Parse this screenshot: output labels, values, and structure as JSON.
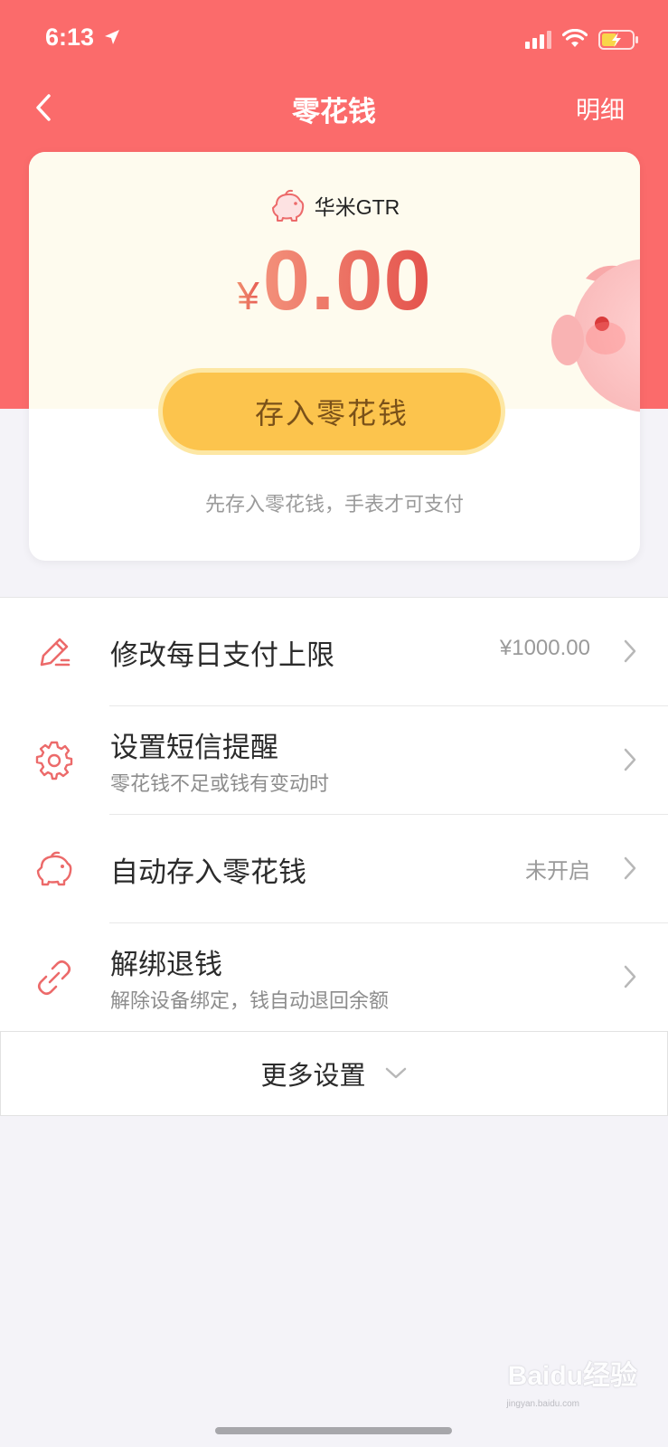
{
  "status_bar": {
    "time": "6:13"
  },
  "nav": {
    "title": "零花钱",
    "detail_link": "明细"
  },
  "card": {
    "device_name": "华米GTR",
    "currency_symbol": "¥",
    "balance": "0.00",
    "deposit_button": "存入零花钱",
    "hint": "先存入零花钱，手表才可支付"
  },
  "menu": {
    "items": [
      {
        "title": "修改每日支付上限",
        "value": "¥1000.00",
        "icon": "pencil-icon"
      },
      {
        "title": "设置短信提醒",
        "subtitle": "零花钱不足或钱有变动时",
        "icon": "gear-icon"
      },
      {
        "title": "自动存入零花钱",
        "value": "未开启",
        "icon": "piggy-bank-icon"
      },
      {
        "title": "解绑退钱",
        "subtitle": "解除设备绑定，钱自动退回余额",
        "icon": "unlink-icon"
      }
    ]
  },
  "more_settings": {
    "label": "更多设置"
  },
  "watermark": {
    "text": "Baidu经验",
    "sub": "jingyan.baidu.com"
  },
  "colors": {
    "header": "#fb6b6b",
    "accent": "#f06a6a",
    "button": "#fcc44d",
    "card_top": "#fefbee"
  }
}
